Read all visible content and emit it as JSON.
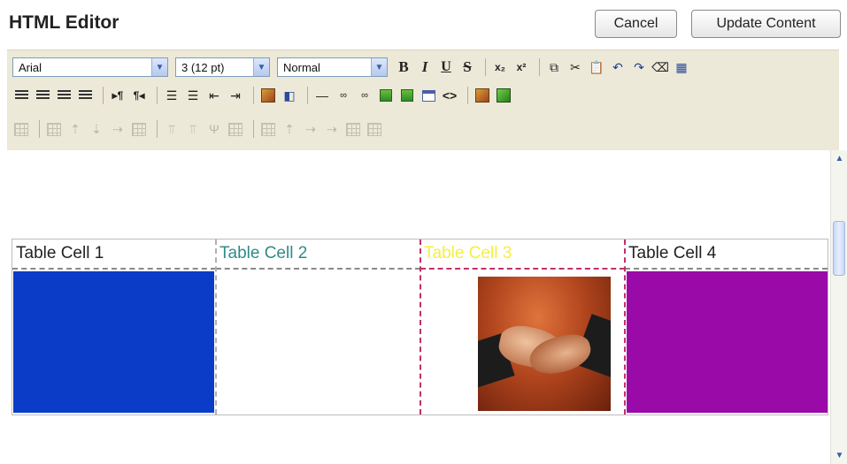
{
  "header": {
    "title": "HTML Editor",
    "cancel_label": "Cancel",
    "update_label": "Update Content"
  },
  "toolbar": {
    "font_family": "Arial",
    "font_size": "3 (12 pt)",
    "format_block": "Normal",
    "bold_glyph": "B",
    "italic_glyph": "I",
    "underline_glyph": "U",
    "strike_glyph": "S"
  },
  "editor": {
    "table": {
      "cells": [
        "Table Cell 1",
        "Table Cell 2",
        "Table Cell 3",
        "Table Cell 4"
      ],
      "colors": {
        "cell2_text": "#2e8b8b",
        "cell3_text": "#f4f040",
        "cell1_bg": "#0a3cc8",
        "cell4_bg": "#990aa8"
      }
    }
  }
}
